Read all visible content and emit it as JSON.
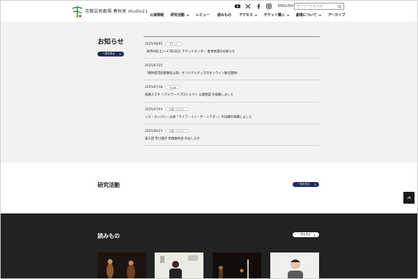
{
  "header": {
    "site_name": "京都芸術劇場 春秋座 studio21",
    "lang_label": "ENGLISH",
    "search_placeholder": "キーワードを入力",
    "nav": [
      {
        "label": "公演情報",
        "has_dropdown": false
      },
      {
        "label": "研究活動",
        "has_dropdown": true
      },
      {
        "label": "レビュー",
        "has_dropdown": false
      },
      {
        "label": "読みもの",
        "has_dropdown": false
      },
      {
        "label": "アクセス",
        "has_dropdown": true
      },
      {
        "label": "チケット購入",
        "has_dropdown": true
      },
      {
        "label": "劇場について",
        "has_dropdown": true
      },
      {
        "label": "アーカイブ",
        "has_dropdown": false
      }
    ]
  },
  "news": {
    "title": "お知らせ",
    "button_label": "一覧を見る",
    "items": [
      {
        "date": "2025/08/05",
        "tag": "チケット",
        "text": "【8月9日(土)〜17日(日)】チケットセンター 夏季休業のお知らせ"
      },
      {
        "date": "2025/07/25",
        "tag": "",
        "text": "「春秋座花形歌舞伎公演」オリジナルグッズのオンライン販売開始!"
      },
      {
        "date": "2025/07/18",
        "tag": "その他",
        "text": "松尾スズキ リアルワークプロジェクト 公開授業 を掲載しました"
      },
      {
        "date": "2025/07/03",
        "tag": "公演・イベント",
        "text": "シス・カンパニー公演「ライフ・イン・ザ・シアター」の詳細を掲載しました"
      },
      {
        "date": "2025/06/23",
        "tag": "公演・イベント",
        "text": "第三回 市川團子 新翔春秋会 のおしらせ"
      }
    ]
  },
  "research": {
    "title": "研究活動",
    "button_label": "一覧を見る"
  },
  "reading": {
    "title": "読みもの",
    "button_label": "一覧を見る"
  },
  "colors": {
    "accent": "#1f2a5c",
    "news_bg": "#f2f2f2",
    "dark_bg": "#222222",
    "logo_green": "#3a8a3a"
  }
}
